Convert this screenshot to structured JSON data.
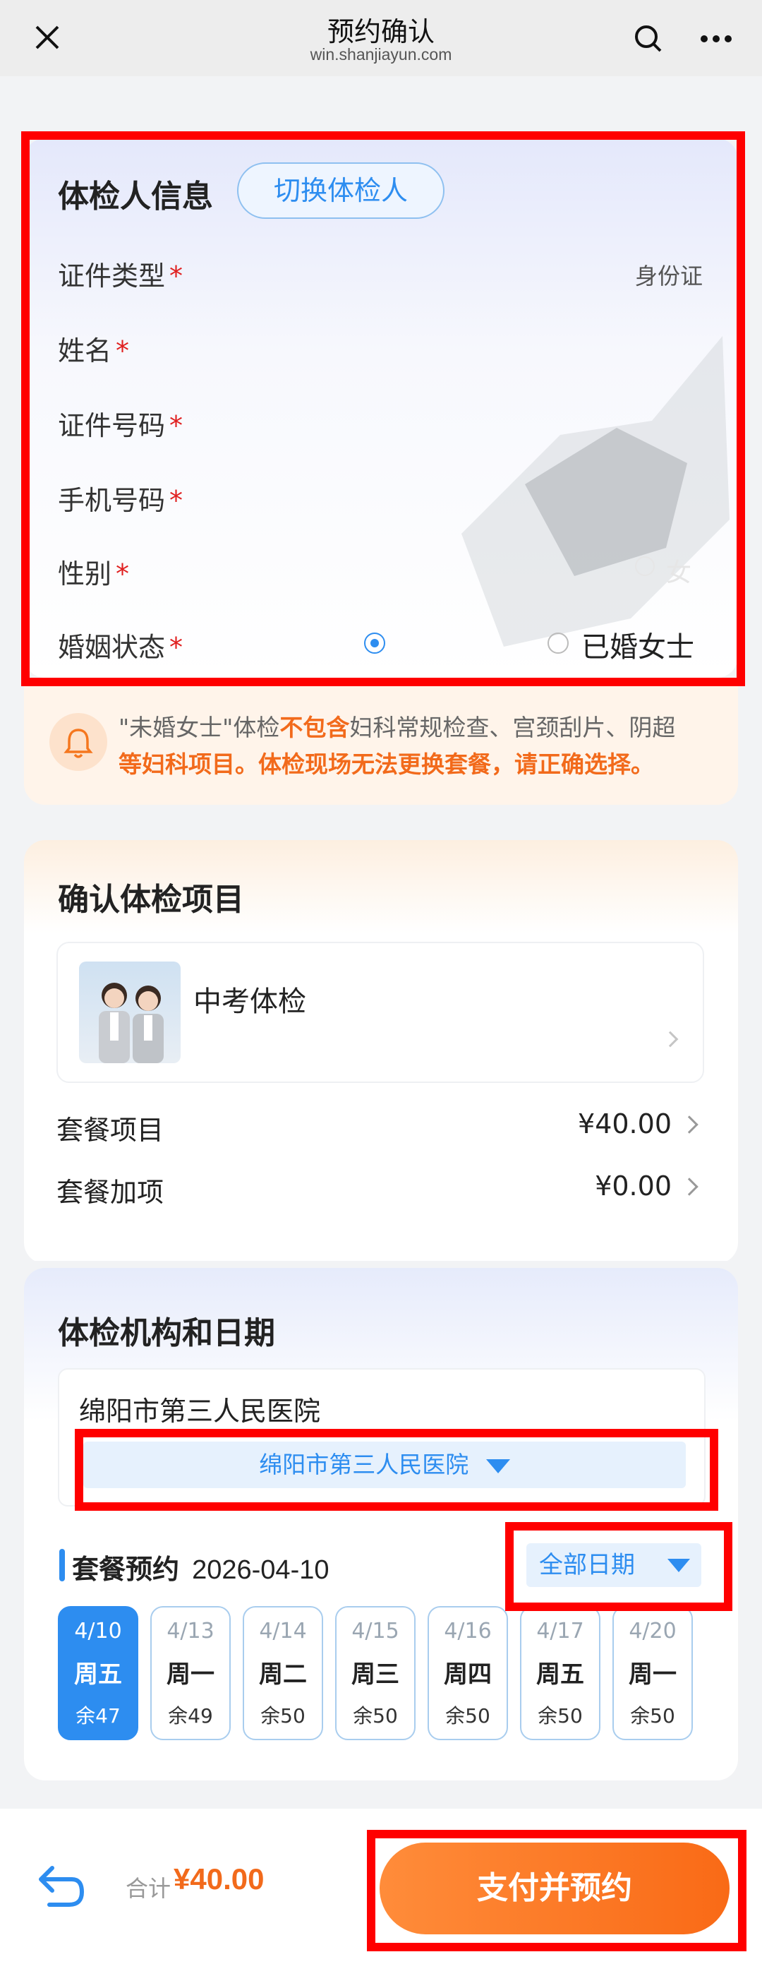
{
  "nav": {
    "title": "预约确认",
    "subtitle": "win.shanjiayun.com"
  },
  "person": {
    "section_title": "体检人信息",
    "switch_label": "切换体检人",
    "fields": [
      {
        "label": "证件类型",
        "value": "身份证"
      },
      {
        "label": "姓名",
        "value": ""
      },
      {
        "label": "证件号码",
        "value": ""
      },
      {
        "label": "手机号码",
        "value": ""
      },
      {
        "label": "性别",
        "value": ""
      },
      {
        "label": "婚姻状态",
        "value": ""
      }
    ],
    "required_mark": "*",
    "gender_visible_option": "女",
    "marital_option_married": "已婚女士"
  },
  "notice": {
    "line1_prefix": "\"未婚女士\"体检",
    "line1_emph": "不包含",
    "line1_suffix": "妇科常规检查、宫颈刮片、阴超",
    "line2": "等妇科项目。体检现场无法更换套餐，请正确选择。"
  },
  "items": {
    "section_title": "确认体检项目",
    "package_name": "中考体检",
    "rows": [
      {
        "label": "套餐项目",
        "value": "¥40.00"
      },
      {
        "label": "套餐加项",
        "value": "¥0.00"
      }
    ]
  },
  "institution": {
    "section_title": "体检机构和日期",
    "hospital_name": "绵阳市第三人民医院",
    "hospital_select": "绵阳市第三人民医院",
    "booking_label": "套餐预约",
    "booking_date": "2026-04-10",
    "all_dates_label": "全部日期",
    "dates": [
      {
        "date": "4/10",
        "weekday": "周五",
        "remain": "余47",
        "selected": true
      },
      {
        "date": "4/13",
        "weekday": "周一",
        "remain": "余49",
        "selected": false
      },
      {
        "date": "4/14",
        "weekday": "周二",
        "remain": "余50",
        "selected": false
      },
      {
        "date": "4/15",
        "weekday": "周三",
        "remain": "余50",
        "selected": false
      },
      {
        "date": "4/16",
        "weekday": "周四",
        "remain": "余50",
        "selected": false
      },
      {
        "date": "4/17",
        "weekday": "周五",
        "remain": "余50",
        "selected": false
      },
      {
        "date": "4/20",
        "weekday": "周一",
        "remain": "余50",
        "selected": false
      }
    ]
  },
  "footer": {
    "total_label": "合计",
    "total_value": "¥40.00",
    "pay_button": "支付并预约"
  },
  "colors": {
    "accent_blue": "#2d8df0",
    "orange": "#f5771f",
    "price_orange": "#f26a1b",
    "highlight_red": "#ff0000"
  }
}
